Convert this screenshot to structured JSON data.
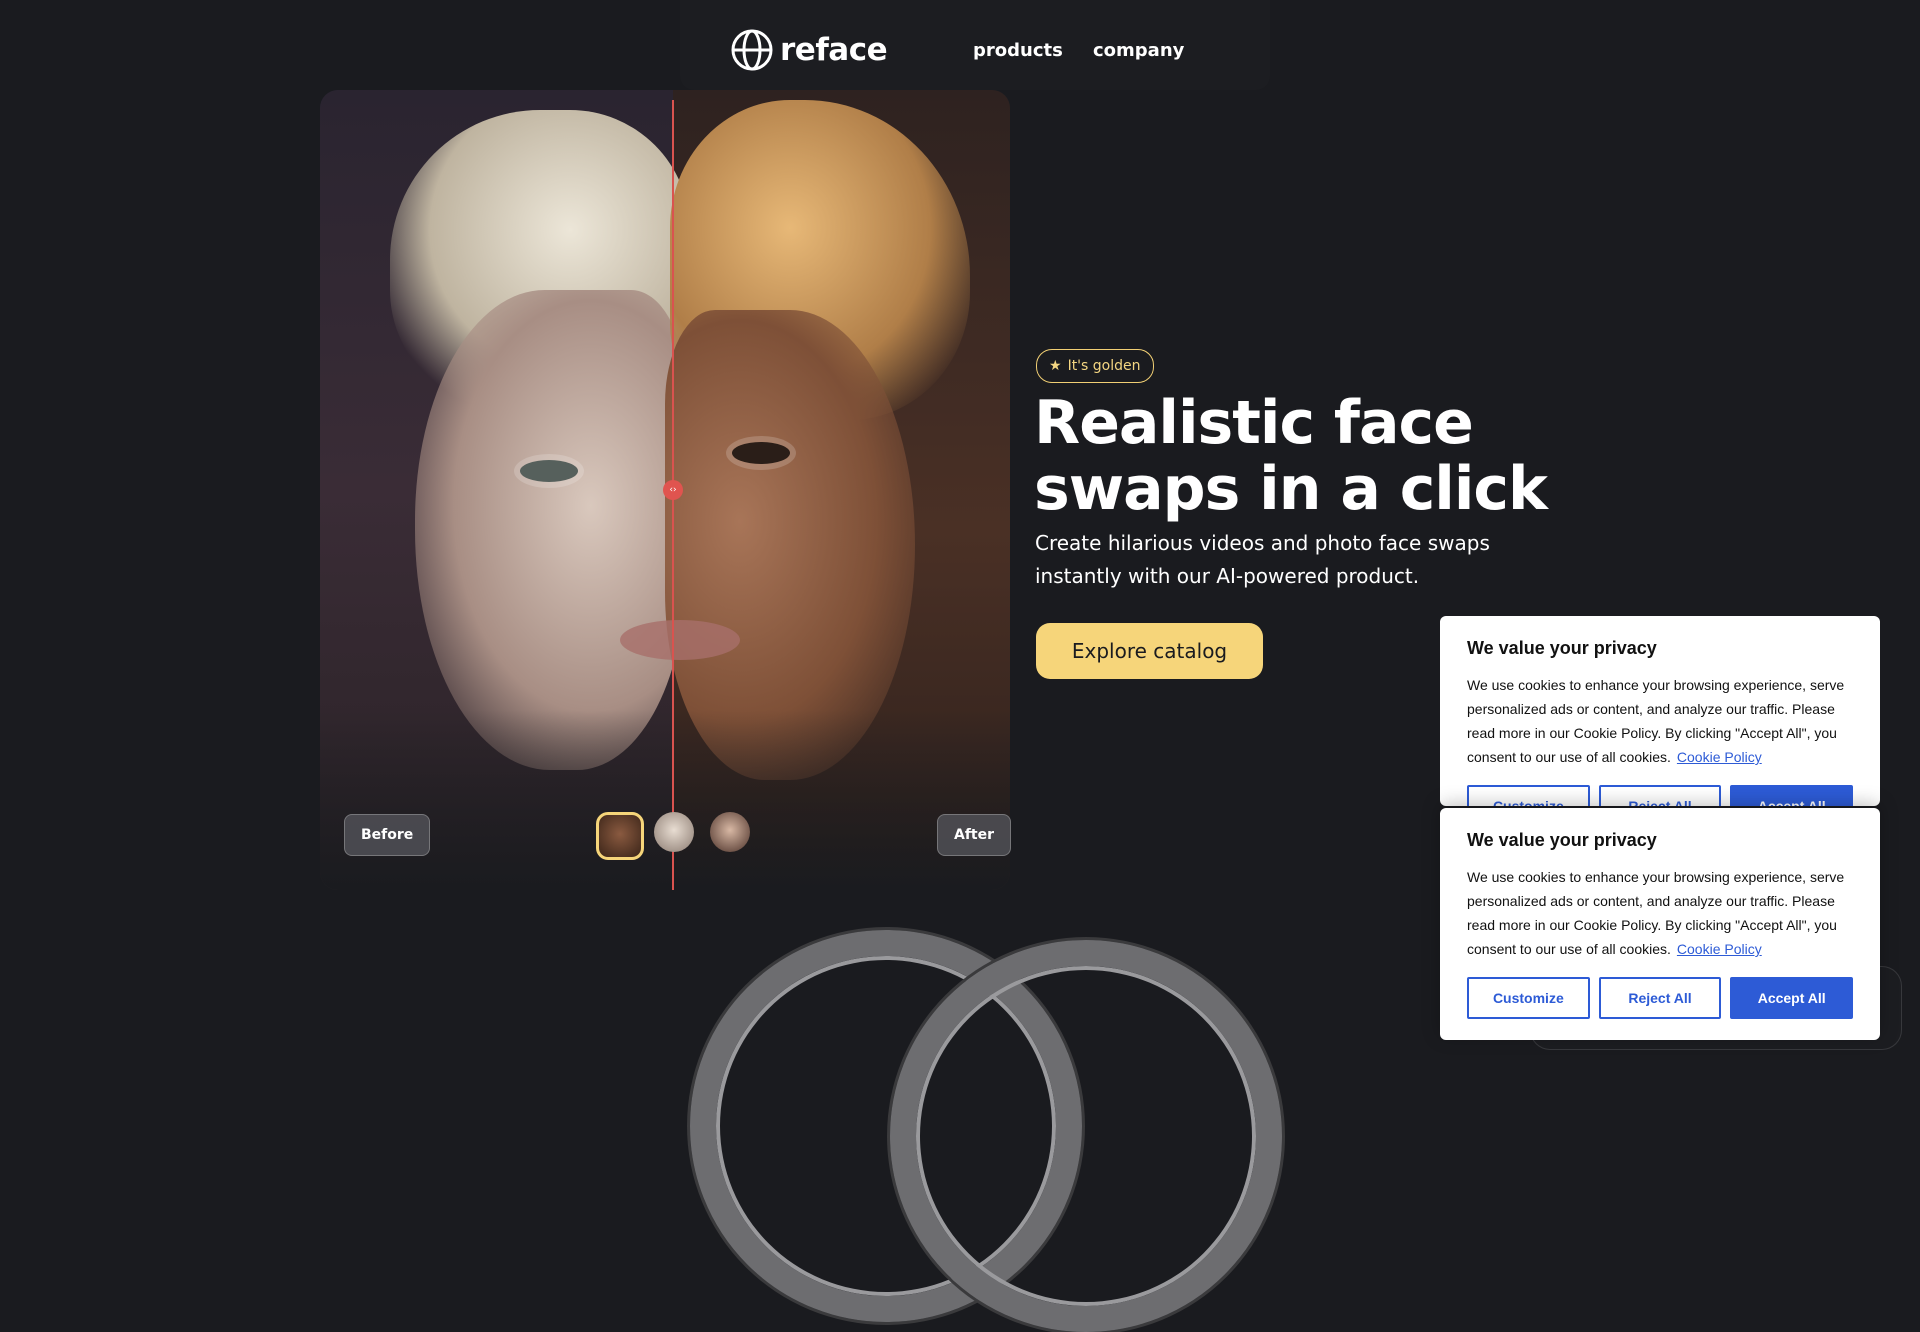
{
  "nav": {
    "brand": "reface",
    "links": [
      "products",
      "company"
    ]
  },
  "hero": {
    "badge": "It's golden",
    "headline": "Realistic face swaps in a click",
    "subtext": "Create hilarious videos and photo face swaps instantly with our AI-powered product.",
    "cta": "Explore catalog",
    "before_label": "Before",
    "after_label": "After"
  },
  "colors": {
    "background": "#1a1b1f",
    "accent_gold": "#f6d57a",
    "split_line": "#d9534f",
    "cookie_blue": "#2d5bd6"
  },
  "cookie": {
    "title": "We value your privacy",
    "text": "We use cookies to enhance your browsing experience, serve personalized ads or content, and analyze our traffic. Please read more in our Cookie Policy. By clicking \"Accept All\", you consent to our use of all cookies.",
    "link": "Cookie Policy",
    "customize": "Customize",
    "reject": "Reject All",
    "accept": "Accept All"
  },
  "icons": {
    "badge": "star-icon",
    "logo": "globe-logo-icon",
    "slider": "code-arrows-icon"
  }
}
